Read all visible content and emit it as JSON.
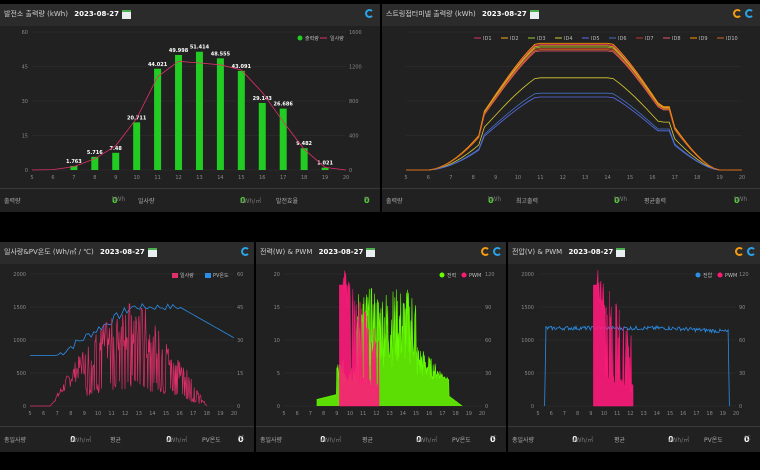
{
  "panel1": {
    "title": "발전소 출력량 (kWh)",
    "date": "2023-08-27",
    "legend": [
      "출력량",
      "일사량"
    ],
    "yleft": [
      "60",
      "45",
      "30",
      "15",
      "0"
    ],
    "yright": [
      "1600",
      "1200",
      "800",
      "400",
      "0"
    ],
    "stats": {
      "l1": "출력량",
      "v1": "0",
      "u1": "kWh",
      "l2": "일사량",
      "v2": "0",
      "u2": "kWh/㎡",
      "l3": "발전효율",
      "v3": "0",
      "u3": "%"
    }
  },
  "panel2": {
    "title": "스트링접터미넬 출력량 (kWh)",
    "date": "2023-08-27",
    "legend": [
      "ID1",
      "ID2",
      "ID3",
      "ID4",
      "ID5",
      "ID6",
      "ID7",
      "ID8",
      "ID9",
      "ID10"
    ],
    "stats": {
      "l1": "출력량",
      "v1": "0",
      "u1": "kWh",
      "l2": "최고출력",
      "v2": "0",
      "u2": "kWh",
      "l3": "평균출력",
      "v3": "0",
      "u3": "kWh"
    }
  },
  "panel3": {
    "title": "일사량&PV온도 (Wh/㎡ / ℃)",
    "date": "2023-08-27",
    "legend": [
      "일사량",
      "PV온도"
    ],
    "yleft": [
      "2000",
      "1500",
      "1000",
      "500",
      "0"
    ],
    "yright": [
      "60",
      "45",
      "30",
      "15",
      "0"
    ],
    "stats": {
      "l1": "총일사량",
      "v1": "0",
      "u1": "kWh/㎡",
      "l2": "평균",
      "v2": "0",
      "u2": "kWh/㎡",
      "l3": "PV온도",
      "v3": "0",
      "u3": "℃"
    }
  },
  "panel4": {
    "title": "전력(W) & PWM",
    "date": "2023-08-27",
    "legend": [
      "전력",
      "PWM"
    ],
    "yleft": [
      "20",
      "15",
      "10",
      "5",
      "0"
    ],
    "yright": [
      "120",
      "90",
      "60",
      "30",
      "0"
    ],
    "stats": {
      "l1": "총일사량",
      "v1": "0",
      "u1": "kWh/㎡",
      "l2": "평균",
      "v2": "0",
      "u2": "kWh/㎡",
      "l3": "PV온도",
      "v3": "0",
      "u3": "℃"
    }
  },
  "panel5": {
    "title": "전압(V) & PWM",
    "date": "2023-08-27",
    "legend": [
      "전압",
      "PWM"
    ],
    "yleft": [
      "2000",
      "1500",
      "1000",
      "500",
      "0"
    ],
    "yright": [
      "120",
      "90",
      "60",
      "30",
      "0"
    ],
    "stats": {
      "l1": "총일사량",
      "v1": "0",
      "u1": "kWh/㎡",
      "l2": "평균",
      "v2": "0",
      "u2": "kWh/㎡",
      "l3": "PV온도",
      "v3": "0",
      "u3": "℃"
    }
  },
  "hours": [
    "5",
    "6",
    "7",
    "8",
    "9",
    "10",
    "11",
    "12",
    "13",
    "14",
    "15",
    "16",
    "17",
    "18",
    "19",
    "20"
  ],
  "colors": {
    "green": "#22cc22",
    "crimson": "#e0306a",
    "blue": "#2a8ee8",
    "lime": "#66ff00",
    "pink": "#ff1a7a"
  },
  "chart_data": [
    {
      "type": "bar",
      "categories": [
        "5",
        "6",
        "7",
        "8",
        "9",
        "10",
        "11",
        "12",
        "13",
        "14",
        "15",
        "16",
        "17",
        "18",
        "19",
        "20"
      ],
      "series": [
        {
          "name": "출력량",
          "values": [
            0,
            0,
            1.763,
            5.716,
            7.48,
            20.711,
            44.021,
            49.998,
            51.414,
            48.555,
            43.091,
            29.143,
            26.686,
            9.482,
            1.021,
            0
          ]
        },
        {
          "name": "일사량",
          "values": [
            0,
            5,
            40,
            130,
            280,
            600,
            1080,
            1260,
            1240,
            1220,
            1160,
            900,
            560,
            240,
            30,
            0
          ]
        }
      ],
      "labels": [
        "1.763",
        "5.716",
        "7.48",
        "20.711",
        "44.021",
        "49.998",
        "51.414",
        "48.555",
        "43.091",
        "29.143",
        "26.686",
        "9.482",
        "1.021"
      ],
      "ylim": [
        0,
        60
      ],
      "y2lim": [
        0,
        1600
      ]
    }
  ]
}
